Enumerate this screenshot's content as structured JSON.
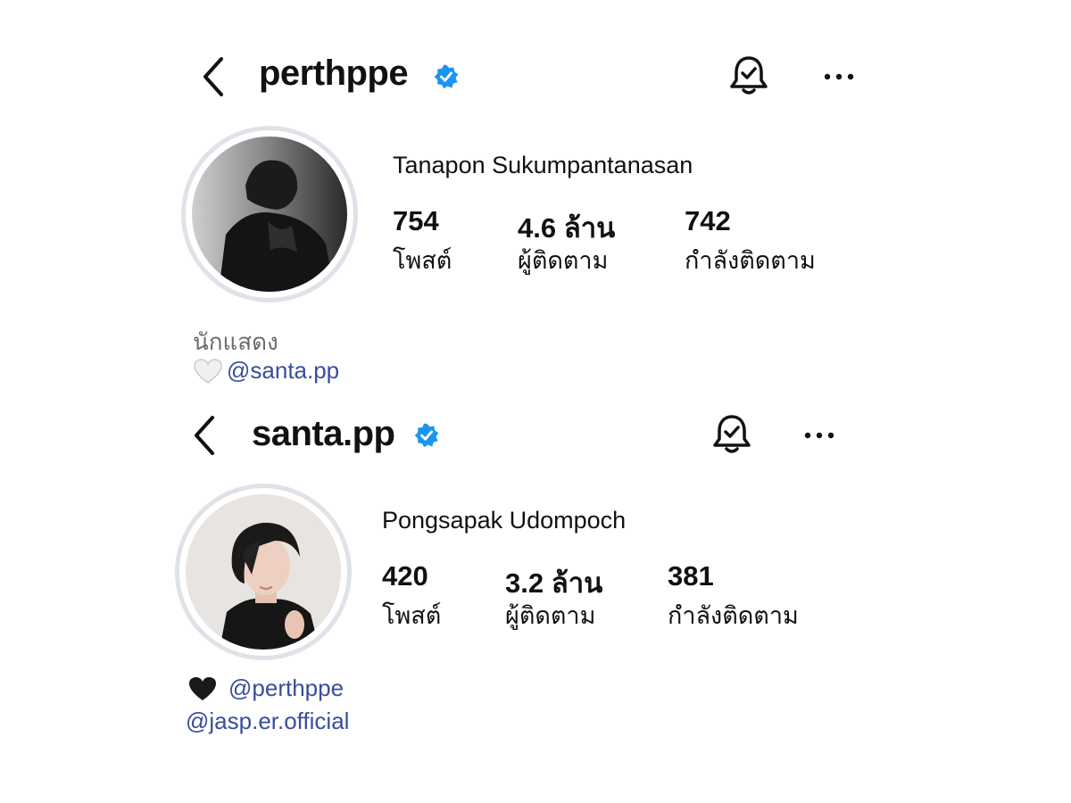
{
  "profiles": [
    {
      "username": "perthppe",
      "verified": true,
      "full_name": "Tanapon Sukumpantanasan",
      "stats": [
        {
          "value": "754",
          "label": "โพสต์"
        },
        {
          "value": "4.6 ล้าน",
          "label": "ผู้ติดตาม"
        },
        {
          "value": "742",
          "label": "กำลังติดตาม"
        }
      ],
      "bio": "นักแสดง",
      "heart_icon": "white-heart",
      "links": [
        "@santa.pp"
      ],
      "avatar_style": "black-and-white"
    },
    {
      "username": "santa.pp",
      "verified": true,
      "full_name": "Pongsapak Udompoch",
      "stats": [
        {
          "value": "420",
          "label": "โพสต์"
        },
        {
          "value": "3.2 ล้าน",
          "label": "ผู้ติดตาม"
        },
        {
          "value": "381",
          "label": "กำลังติดตาม"
        }
      ],
      "heart_icon": "black-heart",
      "links": [
        "@perthppe",
        "@jasp.er.official"
      ],
      "avatar_style": "color"
    }
  ],
  "icons": {
    "back": "chevron-left-icon",
    "bell": "notification-bell-check-icon",
    "more": "more-horizontal-icon"
  },
  "colors": {
    "verified_badge": "#1a95f0",
    "mention_link": "#3a4d9c",
    "bio_text": "#6b6b6b",
    "avatar_ring": "#dfe2e8"
  }
}
